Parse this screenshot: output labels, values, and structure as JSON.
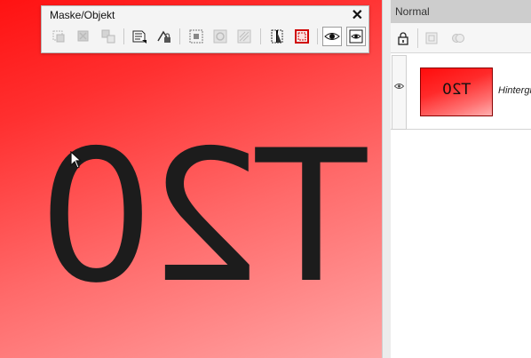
{
  "canvas": {
    "text": "T20",
    "cursor": "arrow-cursor-icon"
  },
  "toolbar": {
    "title": "Maske/Objekt",
    "close": "✕",
    "buttons": [
      "mask-create-icon",
      "mask-remove-icon",
      "mask-apply-icon",
      "mask-from-object-icon",
      "lock-mask-icon",
      "mask-select-icon",
      "mask-disable-icon",
      "mask-invert-icon",
      "mask-gradient-icon",
      "mask-marquee-icon",
      "mask-show-icon",
      "mask-overlay-icon"
    ]
  },
  "layers": {
    "blend_mode": "Normal",
    "tools": [
      "lock-icon",
      "new-layer-icon",
      "merge-icon"
    ],
    "items": [
      {
        "name": "Hintergrund",
        "thumb_text": "T20",
        "visible": true
      }
    ]
  }
}
